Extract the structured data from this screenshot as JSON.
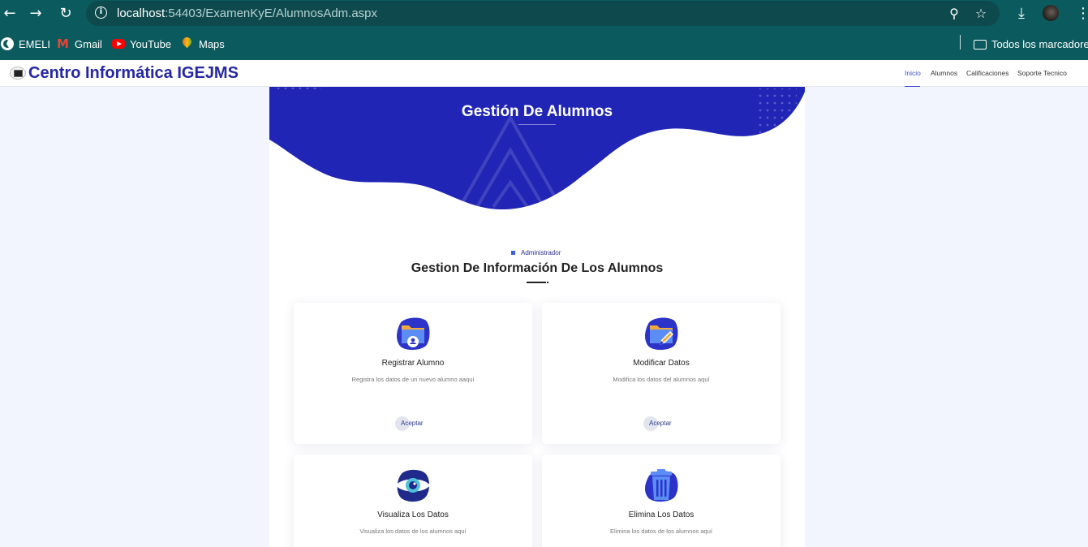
{
  "browser": {
    "url_host": "localhost",
    "url_rest": ":54403/ExamenKyE/AlumnosAdm.aspx",
    "bookmarks": [
      {
        "label": "EMELI",
        "icon": "globe-icon"
      },
      {
        "label": "Gmail",
        "icon": "gmail-icon"
      },
      {
        "label": "YouTube",
        "icon": "youtube-icon"
      },
      {
        "label": "Maps",
        "icon": "maps-icon"
      }
    ],
    "all_bookmarks_label": "Todos los marcadores"
  },
  "site": {
    "title": "Centro Informática IGEJMS",
    "nav": [
      "Inicio",
      "Alumnos",
      "Calificaciones",
      "Soporte Tecnico"
    ],
    "active_nav": "Inicio"
  },
  "hero": {
    "title": "Gestión De Alumnos"
  },
  "section": {
    "badge": "Administrador",
    "title": "Gestion De Información De Los Alumnos"
  },
  "cards": [
    {
      "title": "Registrar Alumno",
      "desc": "Registra los datos de un nuevo alumno aaquí",
      "button": "Aceptar",
      "icon": "register-folder-icon"
    },
    {
      "title": "Modificar Datos",
      "desc": "Modifica los datos del alumnos aquí",
      "button": "Aceptar",
      "icon": "edit-folder-icon"
    },
    {
      "title": "Visualiza Los Datos",
      "desc": "Visualiza los datos de los alumnos aquí",
      "icon": "eye-icon"
    },
    {
      "title": "Elimina Los Datos",
      "desc": "Elimina los datos de los alumnos aquí",
      "icon": "trash-icon"
    }
  ],
  "colors": {
    "chrome": "#0b5a5e",
    "hero_blue": "#2125b5",
    "brand": "#2527a6",
    "accent": "#3b4fd8",
    "page_bg": "#f2f5fd"
  }
}
